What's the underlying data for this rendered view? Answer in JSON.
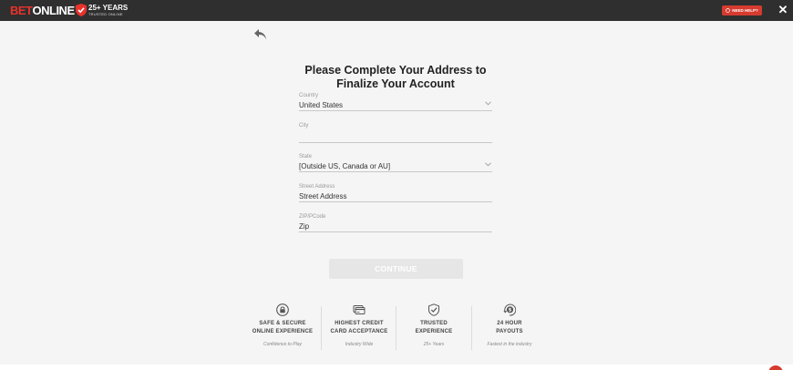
{
  "header": {
    "logo_bet": "BET",
    "logo_online": "ONLINE",
    "badge_main": "25+ YEARS",
    "badge_sub": "TRUSTED ONLINE",
    "need_help": "NEED HELP?",
    "close": "✕",
    "brand_colors": {
      "bar": "#2f2f2f",
      "accent": "#e8322c"
    }
  },
  "form": {
    "title_line1": "Please Complete Your Address to",
    "title_line2": "Finalize Your Account",
    "fields": [
      {
        "label": "Country",
        "value": "United States"
      },
      {
        "label": "City",
        "value": ""
      },
      {
        "label": "State",
        "value": "[Outside US, Canada or AU]"
      },
      {
        "label": "Street Address",
        "value": "Street Address"
      },
      {
        "label": "ZIP/PCode",
        "value": "Zip"
      }
    ],
    "continue_label": "CONTINUE"
  },
  "features": [
    {
      "icon": "lock-icon",
      "title_line1": "SAFE & SECURE",
      "title_line2": "ONLINE EXPERIENCE",
      "subtitle": "Confidence to Play"
    },
    {
      "icon": "credit-card-icon",
      "title_line1": "HIGHEST CREDIT",
      "title_line2": "CARD ACCEPTANCE",
      "subtitle": "Industry Wide"
    },
    {
      "icon": "shield-check-icon",
      "title_line1": "TRUSTED",
      "title_line2": "EXPERIENCE",
      "subtitle": "25+ Years"
    },
    {
      "icon": "clock-dollar-icon",
      "title_line1": "24 HOUR",
      "title_line2": "PAYOUTS",
      "subtitle": "Fastest in the industry"
    }
  ]
}
